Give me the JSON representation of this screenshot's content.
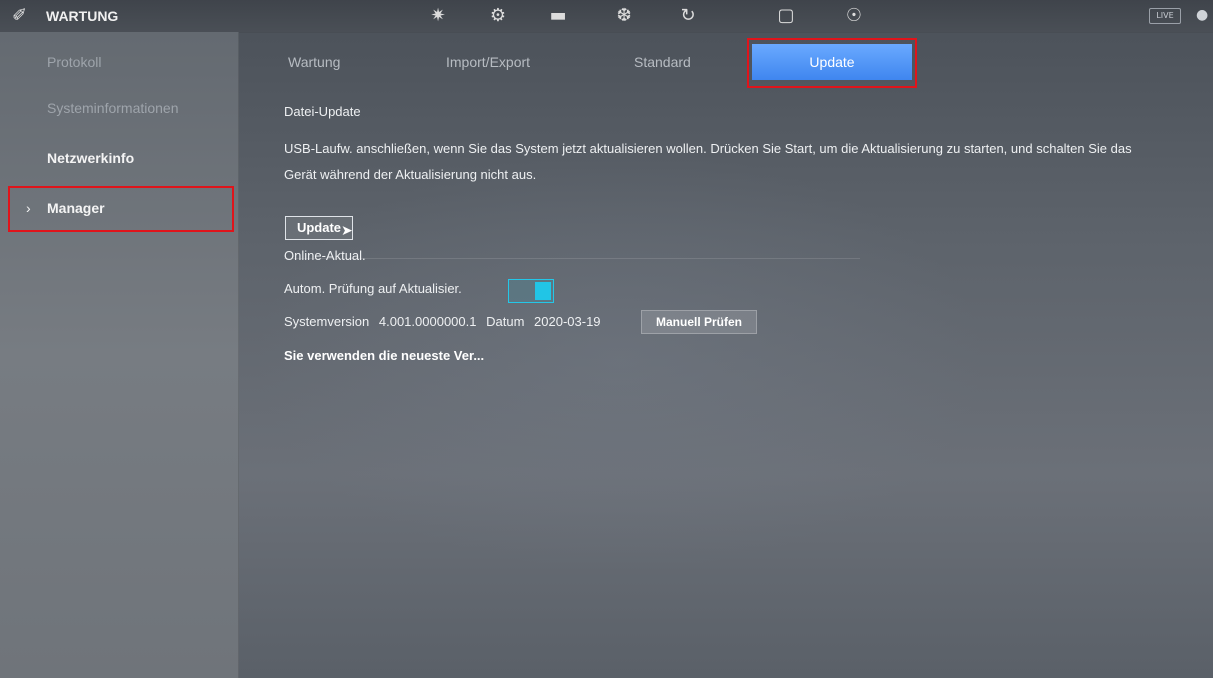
{
  "app": {
    "title": "WARTUNG",
    "live_label": "LIVE"
  },
  "top_icons": [
    "film-reel-icon",
    "gear-box-icon",
    "storage-disk-icon",
    "gauge-icon",
    "refresh-icon",
    "monitor-icon",
    "headset-icon"
  ],
  "sidebar": {
    "items": [
      {
        "label": "Protokoll"
      },
      {
        "label": "Systeminformationen"
      },
      {
        "label": "Netzwerkinfo"
      },
      {
        "label": "Manager"
      }
    ],
    "active_index": 3
  },
  "tabs": [
    {
      "label": "Wartung"
    },
    {
      "label": "Import/Export"
    },
    {
      "label": "Standard"
    },
    {
      "label": "Update"
    }
  ],
  "content": {
    "file_update_title": "Datei-Update",
    "description": "USB-Laufw. anschließen, wenn Sie das System jetzt aktualisieren wollen. Drücken Sie Start, um die Aktualisierung zu starten, und schalten Sie das Gerät während der Aktualisierung nicht aus.",
    "update_button": "Update",
    "online_title": "Online-Aktual.",
    "auto_check_label": "Autom. Prüfung auf Aktualisier.",
    "auto_check_enabled": true,
    "system_version_label": "Systemversion",
    "system_version": "4.001.0000000.1",
    "date_label": "Datum",
    "date": "2020-03-19",
    "manual_check_button": "Manuell Prüfen",
    "status_text": "Sie verwenden die neueste Ver..."
  },
  "colors": {
    "accent_tab": "#3f86ef",
    "toggle": "#21c5e6",
    "highlight_frame": "#e0141b"
  }
}
